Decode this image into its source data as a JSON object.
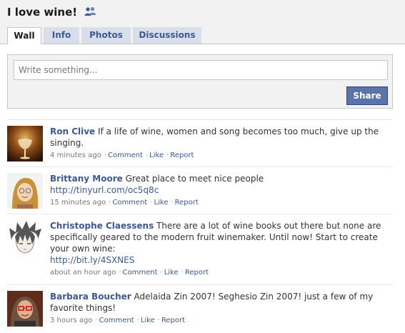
{
  "group": {
    "title": "I love wine!",
    "icon": "group-members-icon"
  },
  "tabs": [
    {
      "label": "Wall",
      "active": true
    },
    {
      "label": "Info",
      "active": false
    },
    {
      "label": "Photos",
      "active": false
    },
    {
      "label": "Discussions",
      "active": false
    }
  ],
  "composer": {
    "placeholder": "Write something...",
    "share_label": "Share"
  },
  "colors": {
    "link": "#3b5998",
    "share_button": "#5b74a8",
    "tab_background": "#d8dfea"
  },
  "posts": [
    {
      "author": "Ron Clive",
      "text": "If a life of wine, women and song becomes too much, give up the singing.",
      "link": "",
      "time": "4 minutes ago",
      "actions": [
        "Comment",
        "Like",
        "Report"
      ],
      "avatar": "wine-glass-photo"
    },
    {
      "author": "Brittany Moore",
      "text": "Great place to meet nice people",
      "link": "http://tinyurl.com/oc5q8c",
      "time": "15 minutes ago",
      "actions": [
        "Comment",
        "Like",
        "Report"
      ],
      "avatar": "woman-with-glasses-photo"
    },
    {
      "author": "Christophe Claessens",
      "text": "There are a lot of wine books out there but none are specifically geared to the modern fruit winemaker. Until now! Start to create your own wine:",
      "link": "http://bit.ly/4SXNES",
      "time": "about an hour ago",
      "actions": [
        "Comment",
        "Like",
        "Report"
      ],
      "avatar": "anime-character-drawing"
    },
    {
      "author": "Barbara Boucher",
      "text": "Adelaida Zin 2007! Seghesio Zin 2007! just a few of my favorite things!",
      "link": "",
      "time": "3 hours ago",
      "actions": [
        "Comment",
        "Like",
        "Report"
      ],
      "avatar": "woman-red-glasses-photo"
    }
  ]
}
